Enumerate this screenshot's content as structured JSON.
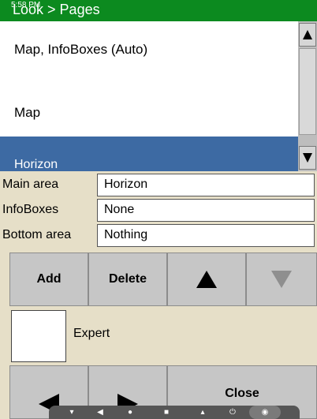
{
  "titlebar": {
    "title": "Look > Pages",
    "status_time": "5:58 PM"
  },
  "pages": {
    "items": [
      {
        "label": "Map, InfoBoxes (Auto)"
      },
      {
        "label": "Map"
      },
      {
        "label": "Horizon",
        "selected": true
      }
    ]
  },
  "properties": [
    {
      "label": "Main area",
      "value": "Horizon"
    },
    {
      "label": "InfoBoxes",
      "value": "None"
    },
    {
      "label": "Bottom area",
      "value": "Nothing"
    }
  ],
  "buttons": {
    "add": "Add",
    "delete": "Delete",
    "move_up_icon": "triangle-up",
    "move_down_icon": "triangle-down",
    "close": "Close",
    "prev_icon": "triangle-left",
    "next_icon": "triangle-right"
  },
  "expert": {
    "label": "Expert",
    "checked": false
  },
  "navbar": {
    "icons": [
      "volume-down-icon",
      "back-icon",
      "home-icon",
      "recents-icon",
      "volume-up-icon",
      "power-icon",
      "camera-icon"
    ]
  },
  "colors": {
    "titlebar_bg": "#0c8a1f",
    "selected_bg": "#3d6aa3",
    "panel_bg": "#e6dfc8",
    "button_bg": "#c6c6c6",
    "disabled_arrow": "#8f8f8f"
  }
}
